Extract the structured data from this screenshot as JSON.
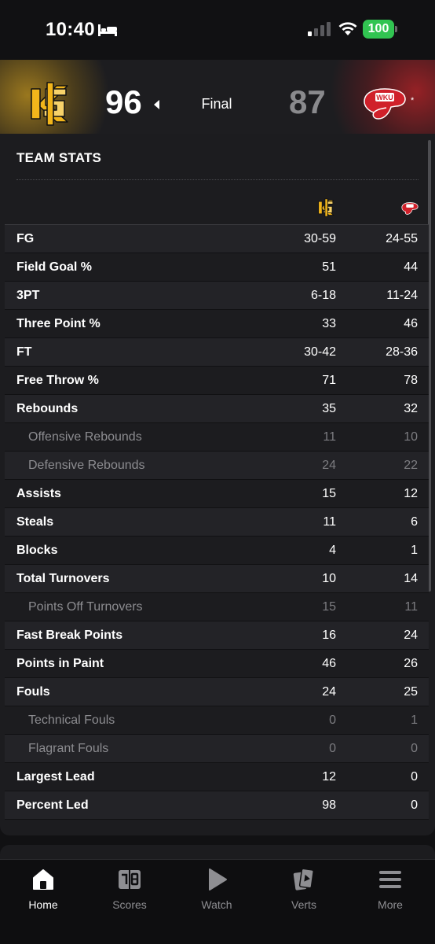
{
  "status_bar": {
    "time": "10:40",
    "battery": "100",
    "icons": [
      "bed-icon",
      "cellular-signal-icon",
      "wifi-icon",
      "battery-icon"
    ]
  },
  "game": {
    "home": {
      "name": "Kennesaw State",
      "score": "96",
      "logo_icon": "kennesaw-state-logo",
      "color": "#c4961e"
    },
    "away": {
      "name": "WKU",
      "score": "87",
      "logo_icon": "wku-logo",
      "rank_mark": "*",
      "color": "#c8232c"
    },
    "status": "Final"
  },
  "team_stats": {
    "title": "TEAM STATS",
    "rows": [
      {
        "label": "FG",
        "home": "30-59",
        "away": "24-55",
        "sub": false
      },
      {
        "label": "Field Goal %",
        "home": "51",
        "away": "44",
        "sub": false
      },
      {
        "label": "3PT",
        "home": "6-18",
        "away": "11-24",
        "sub": false
      },
      {
        "label": "Three Point %",
        "home": "33",
        "away": "46",
        "sub": false
      },
      {
        "label": "FT",
        "home": "30-42",
        "away": "28-36",
        "sub": false
      },
      {
        "label": "Free Throw %",
        "home": "71",
        "away": "78",
        "sub": false
      },
      {
        "label": "Rebounds",
        "home": "35",
        "away": "32",
        "sub": false
      },
      {
        "label": "Offensive Rebounds",
        "home": "11",
        "away": "10",
        "sub": true
      },
      {
        "label": "Defensive Rebounds",
        "home": "24",
        "away": "22",
        "sub": true
      },
      {
        "label": "Assists",
        "home": "15",
        "away": "12",
        "sub": false
      },
      {
        "label": "Steals",
        "home": "11",
        "away": "6",
        "sub": false
      },
      {
        "label": "Blocks",
        "home": "4",
        "away": "1",
        "sub": false
      },
      {
        "label": "Total Turnovers",
        "home": "10",
        "away": "14",
        "sub": false
      },
      {
        "label": "Points Off Turnovers",
        "home": "15",
        "away": "11",
        "sub": true
      },
      {
        "label": "Fast Break Points",
        "home": "16",
        "away": "24",
        "sub": false
      },
      {
        "label": "Points in Paint",
        "home": "46",
        "away": "26",
        "sub": false
      },
      {
        "label": "Fouls",
        "home": "24",
        "away": "25",
        "sub": false
      },
      {
        "label": "Technical Fouls",
        "home": "0",
        "away": "1",
        "sub": true
      },
      {
        "label": "Flagrant Fouls",
        "home": "0",
        "away": "0",
        "sub": true
      },
      {
        "label": "Largest Lead",
        "home": "12",
        "away": "0",
        "sub": false
      },
      {
        "label": "Percent Led",
        "home": "98",
        "away": "0",
        "sub": false
      }
    ]
  },
  "tab_bar": {
    "tabs": [
      {
        "label": "Home",
        "icon": "home-icon",
        "active": true
      },
      {
        "label": "Scores",
        "icon": "scoreboard-icon",
        "active": false
      },
      {
        "label": "Watch",
        "icon": "play-icon",
        "active": false
      },
      {
        "label": "Verts",
        "icon": "verts-icon",
        "active": false
      },
      {
        "label": "More",
        "icon": "menu-icon",
        "active": false
      }
    ]
  }
}
